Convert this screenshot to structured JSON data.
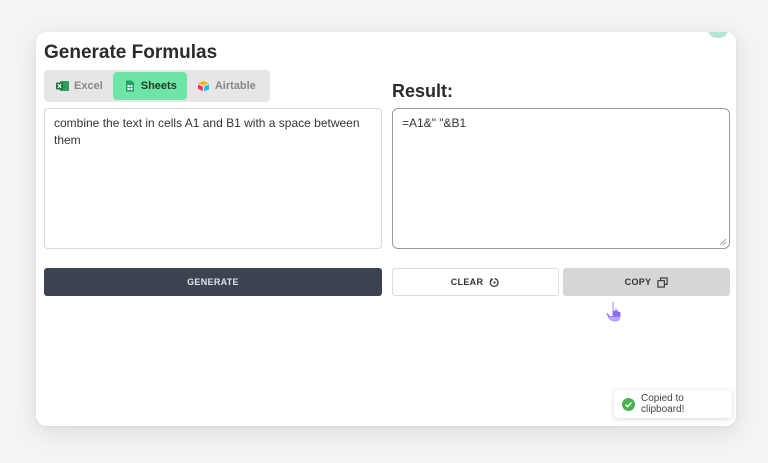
{
  "app": {
    "title": "Generate Formulas"
  },
  "tabs": [
    {
      "label": "Excel",
      "icon": "excel-icon",
      "active": false
    },
    {
      "label": "Sheets",
      "icon": "sheets-icon",
      "active": true
    },
    {
      "label": "Airtable",
      "icon": "airtable-icon",
      "active": false
    }
  ],
  "input": {
    "value": "combine the text in cells A1 and B1 with a space between them"
  },
  "result": {
    "label": "Result:",
    "value": "=A1&\" \"&B1"
  },
  "buttons": {
    "generate_label": "GENERATE",
    "clear_label": "CLEAR",
    "copy_label": "COPY"
  },
  "toast": {
    "message": "Copied to clipboard!"
  },
  "colors": {
    "active_tab": "#6ee4a6",
    "generate_button": "#3d4350",
    "copy_button": "#d6d6d6",
    "toast_check": "#4caf50"
  }
}
